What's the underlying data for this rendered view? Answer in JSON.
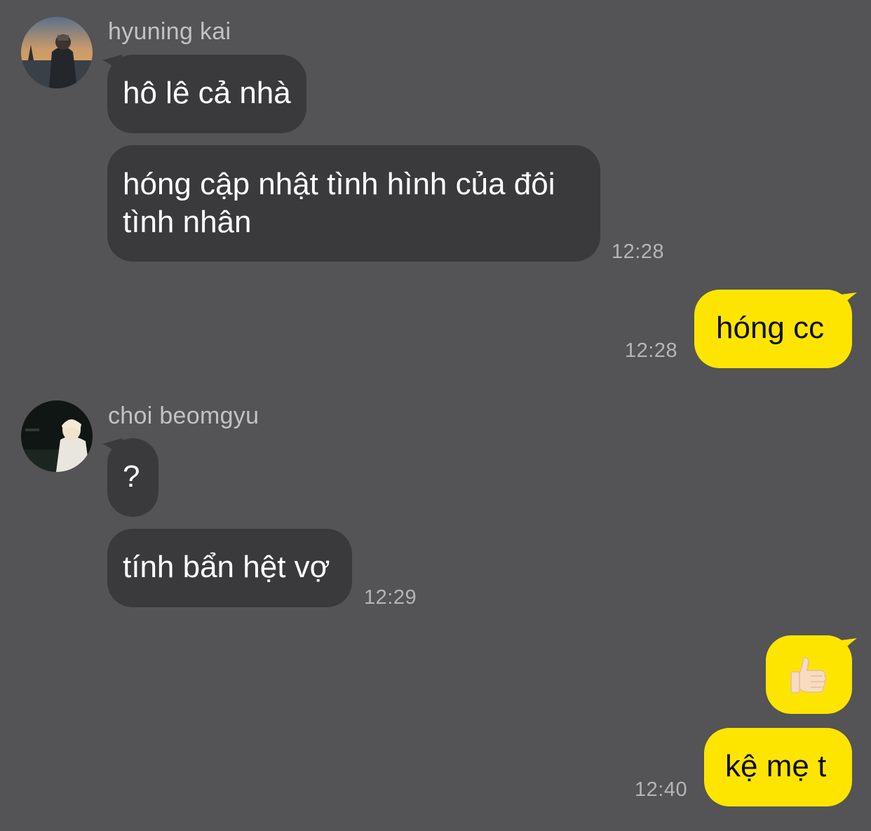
{
  "messages": [
    {
      "sender": "hyuning kai",
      "avatar": "hyuning-kai-avatar",
      "bubbles": [
        "hô lê cả nhà",
        "hóng cập nhật tình hình của đôi tình nhân"
      ],
      "time": "12:28"
    },
    {
      "outgoing": true,
      "bubbles": [
        "hóng cc"
      ],
      "time": "12:28"
    },
    {
      "sender": "choi beomgyu",
      "avatar": "choi-beomgyu-avatar",
      "bubbles": [
        "?",
        "tính bẩn hệt vợ"
      ],
      "time": "12:29"
    },
    {
      "outgoing": true,
      "bubbles": [
        "thumbs-up-emoji",
        "kệ mẹ t"
      ],
      "time": "12:40"
    }
  ],
  "colors": {
    "background": "#545355",
    "incoming_bubble": "#3a393c",
    "outgoing_bubble": "#fee500",
    "timestamp": "#b5b5b7",
    "sender_name": "#c2c2c4"
  }
}
